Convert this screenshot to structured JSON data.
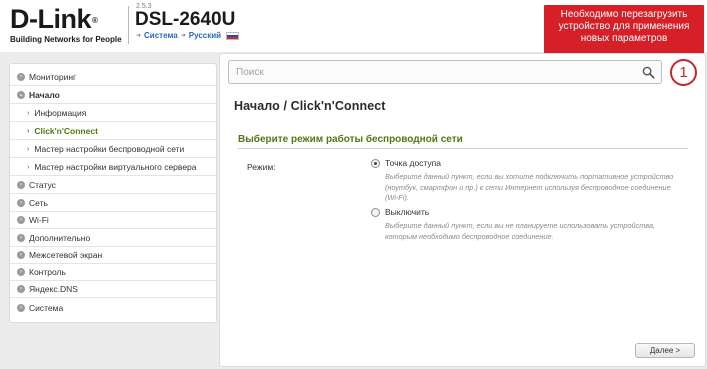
{
  "header": {
    "logo_text": "D-Link",
    "logo_tagline": "Building Networks for People",
    "firmware": "2.5.3",
    "model": "DSL-2640U",
    "system_link": "Система",
    "language_link": "Русский",
    "flag_icon": "russian-flag-icon"
  },
  "notice": {
    "text": "Необходимо перезагрузить устройство для применения новых параметров",
    "color": "#d61f26"
  },
  "sidebar": {
    "items": [
      {
        "label": "Мониторинг"
      },
      {
        "label": "Начало"
      },
      {
        "label": "Информация"
      },
      {
        "label": "Click'n'Connect"
      },
      {
        "label": "Мастер настройки беспроводной сети"
      },
      {
        "label": "Мастер настройки виртуального сервера"
      },
      {
        "label": "Статус"
      },
      {
        "label": "Сеть"
      },
      {
        "label": "Wi-Fi"
      },
      {
        "label": "Дополнительно"
      },
      {
        "label": "Межсетевой экран"
      },
      {
        "label": "Контроль"
      },
      {
        "label": "Яндекс.DNS"
      },
      {
        "label": "Система"
      }
    ],
    "active_color": "#4f7a13"
  },
  "search": {
    "placeholder": "Поиск",
    "icon": "search-icon"
  },
  "badge": "1",
  "main": {
    "title": "Начало /  Click'n'Connect",
    "section_title": "Выберите режим работы беспроводной сети",
    "mode_label": "Режим:",
    "options": [
      {
        "label": "Точка доступа",
        "selected": true,
        "description": "Выберите данный пункт, если вы хотите подключить портативное устройство (ноутбук, смартфон и пр.) к сети Интернет используя беспроводное соединение (Wi-Fi)."
      },
      {
        "label": "Выключить",
        "selected": false,
        "description": "Выберите данный пункт, если вы не планируете использовать устройства, которым необходимо беспроводное соединение."
      }
    ],
    "next_button": "Далее >"
  }
}
